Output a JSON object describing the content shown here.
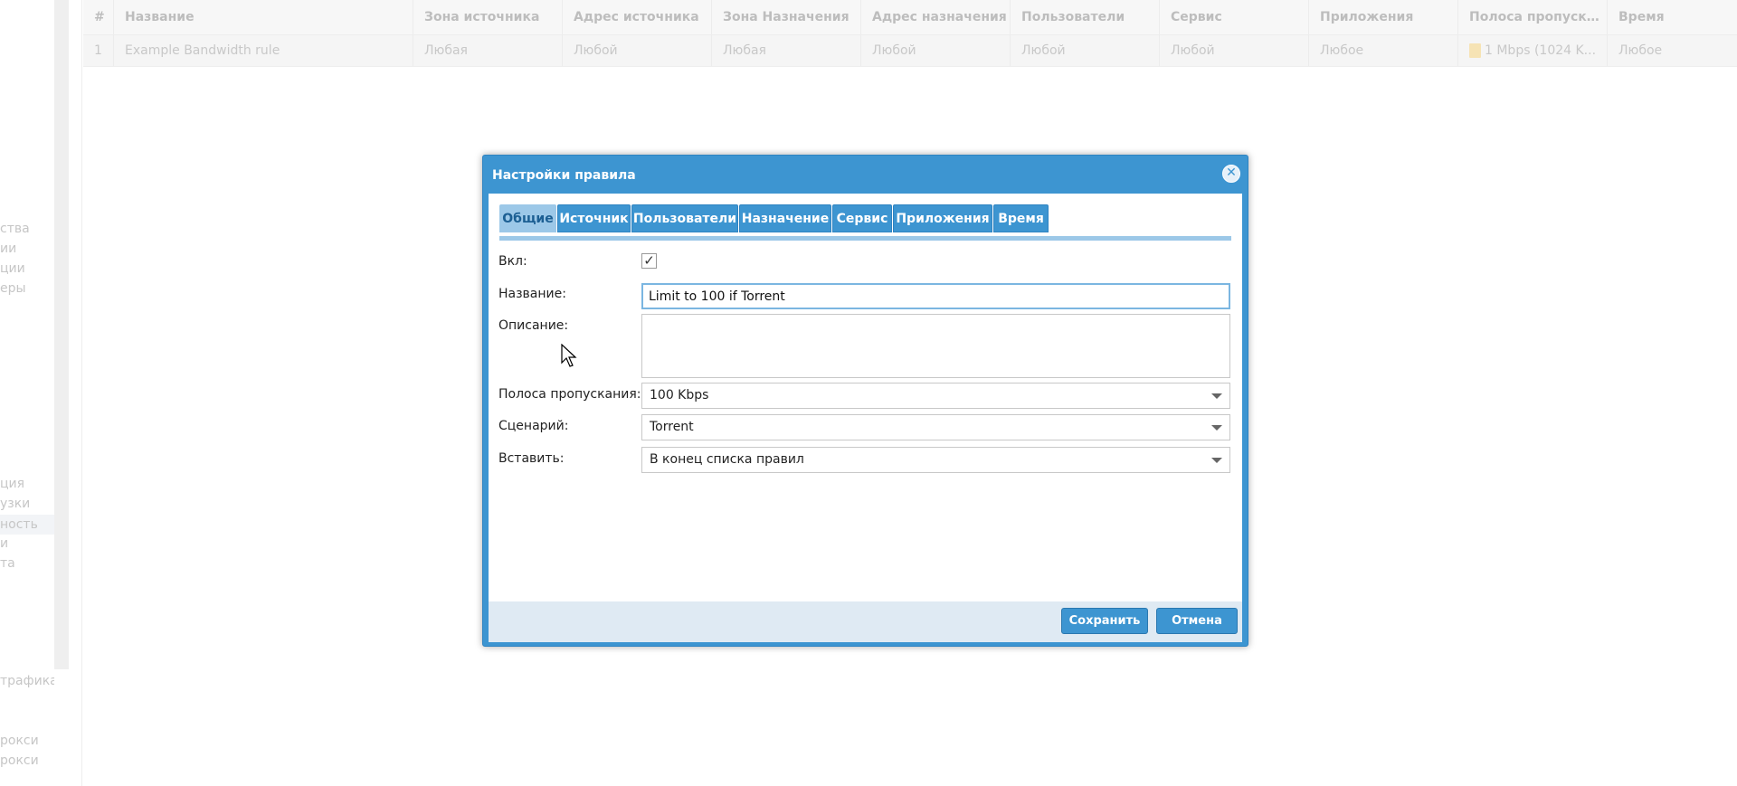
{
  "sidebar": {
    "items": [
      "ства",
      "ии",
      "ции",
      "еры",
      "ция",
      "узки",
      "ность",
      "и",
      "та",
      "трафика",
      "рокси",
      "рокси"
    ]
  },
  "grid": {
    "columns": [
      "#",
      "Название",
      "Зона источника",
      "Адрес источника",
      "Зона Назначения",
      "Адрес назначения",
      "Пользователи",
      "Сервис",
      "Приложения",
      "Полоса пропуска...",
      "Время"
    ],
    "rows": [
      {
        "num": "1",
        "name": "Example Bandwidth rule",
        "src_zone": "Любая",
        "src_addr": "Любой",
        "dst_zone": "Любая",
        "dst_addr": "Любой",
        "users": "Любой",
        "service": "Любой",
        "apps": "Любое",
        "bandwidth": "1 Mbps (1024 K...",
        "time": "Любое"
      }
    ]
  },
  "dialog": {
    "title": "Настройки правила",
    "close_icon": "close-circle-icon",
    "tabs": [
      "Общие",
      "Источник",
      "Пользователи",
      "Назначение",
      "Сервис",
      "Приложения",
      "Время"
    ],
    "active_tab": "Общие",
    "form": {
      "enabled_label": "Вкл:",
      "enabled_mark": "✓",
      "enabled": true,
      "name_label": "Название:",
      "name_value": "Limit to 100 if Torrent",
      "description_label": "Описание:",
      "description_value": "",
      "bandwidth_label": "Полоса пропускания:",
      "bandwidth_value": "100 Kbps",
      "scenario_label": "Сценарий:",
      "scenario_value": "Torrent",
      "insert_label": "Вставить:",
      "insert_value": "В конец списка правил"
    },
    "buttons": {
      "save": "Сохранить",
      "cancel": "Отмена"
    }
  }
}
